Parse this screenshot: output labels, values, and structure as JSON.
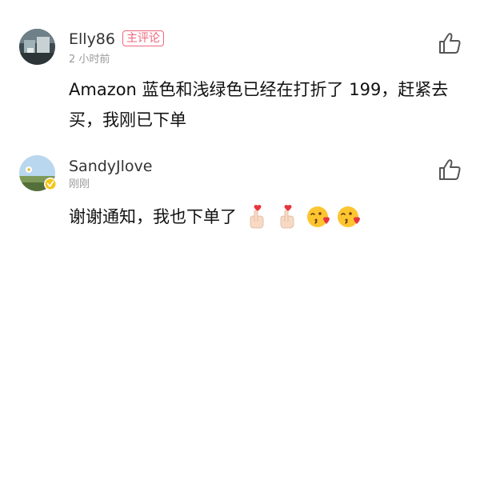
{
  "comments": [
    {
      "username": "Elly86",
      "badge": "主评论",
      "time": "2 小时前",
      "text": "Amazon 蓝色和浅绿色已经在打折了 199，赶紧去买，我刚已下单"
    },
    {
      "username": "SandyJlove",
      "time": "刚刚",
      "text": "谢谢通知，我也下单了",
      "emojis": [
        "finger-heart-icon",
        "finger-heart-icon",
        "kissing-heart-face-icon",
        "kissing-heart-face-icon"
      ]
    }
  ],
  "colors": {
    "badge": "#f0647a",
    "username": "#333333",
    "time": "#9a9a9a",
    "body": "#111111",
    "verified": "#f5c518"
  }
}
